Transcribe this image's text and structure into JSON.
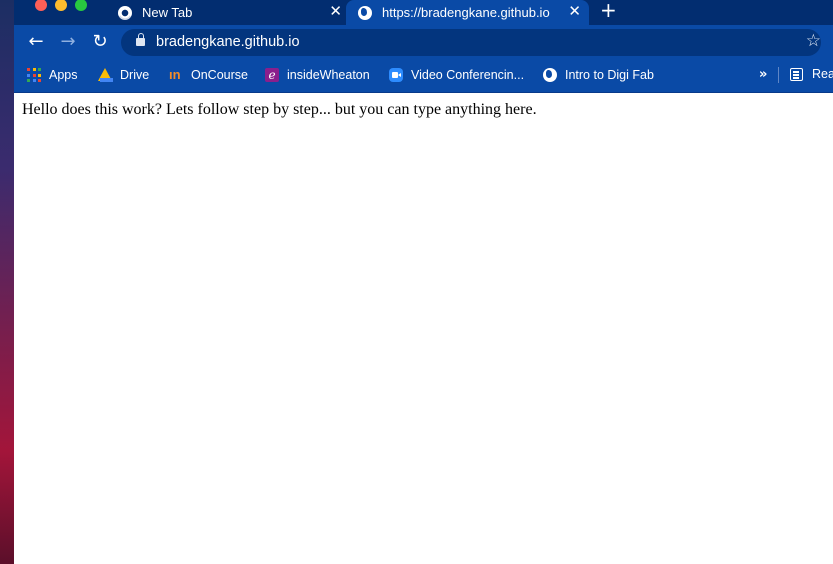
{
  "tabs": [
    {
      "title": "New Tab",
      "icon": "chrome-icon",
      "active": false
    },
    {
      "title": "https://bradengkane.github.io",
      "icon": "globe-icon",
      "active": true
    }
  ],
  "toolbar": {
    "url": "bradengkane.github.io"
  },
  "bookmarks": [
    {
      "label": "Apps",
      "icon": "apps-grid-icon"
    },
    {
      "label": "Drive",
      "icon": "google-drive-icon"
    },
    {
      "label": "OnCourse",
      "icon": "oncourse-icon"
    },
    {
      "label": "insideWheaton",
      "icon": "inside-wheaton-icon"
    },
    {
      "label": "Video Conferencin...",
      "icon": "zoom-icon"
    },
    {
      "label": "Intro to Digi Fab",
      "icon": "globe-icon"
    }
  ],
  "reading_list_label": "Rea",
  "page": {
    "text": "Hello does this work? Lets follow step by step... but you can type anything here."
  },
  "colors": {
    "tabstrip": "#022d70",
    "toolbar": "#0a4aa6",
    "omnibox": "#03357e"
  }
}
